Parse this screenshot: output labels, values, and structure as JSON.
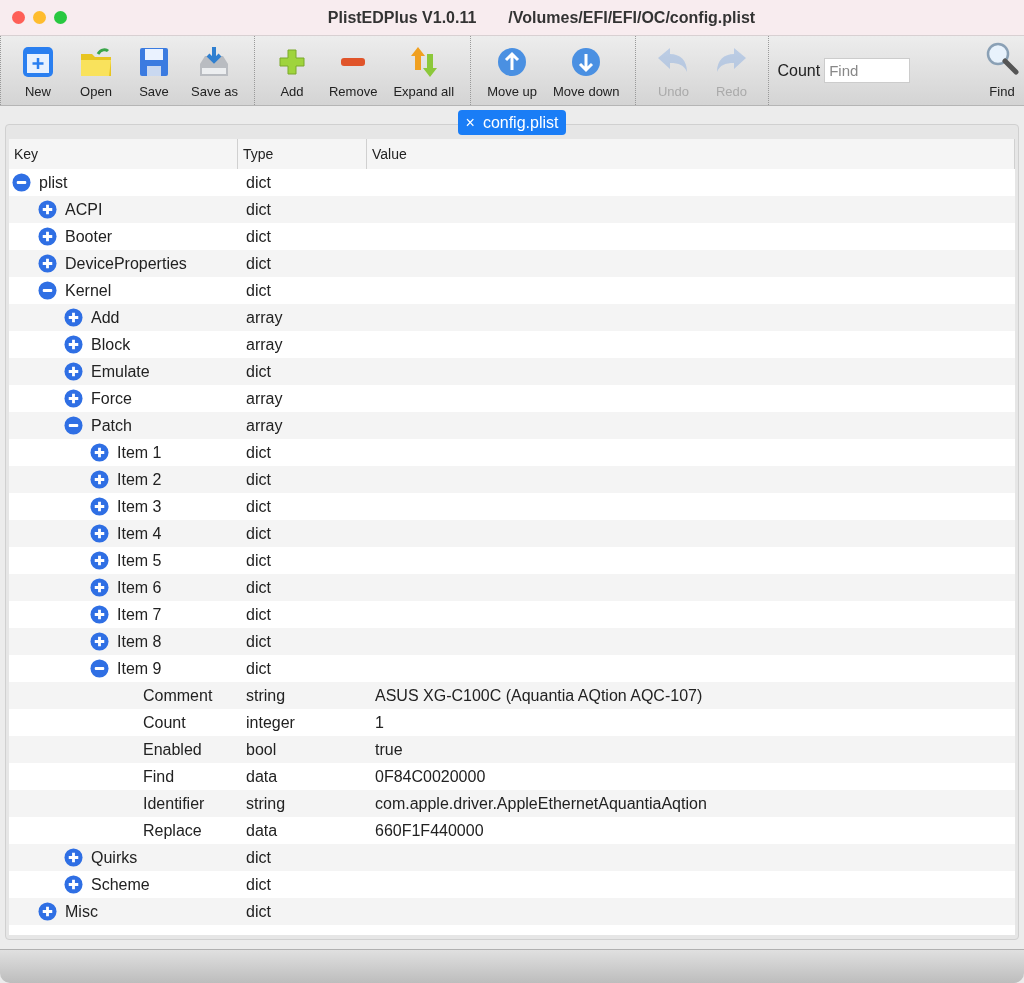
{
  "window": {
    "title": "PlistEDPlus V1.0.11",
    "path": "/Volumes/EFI/EFI/OC/config.plist"
  },
  "toolbar": {
    "groups": [
      [
        {
          "kind": "new",
          "label": "New",
          "disabled": false
        },
        {
          "kind": "open",
          "label": "Open",
          "disabled": false
        },
        {
          "kind": "save",
          "label": "Save",
          "disabled": false
        },
        {
          "kind": "saveas",
          "label": "Save as",
          "disabled": false
        }
      ],
      [
        {
          "kind": "add",
          "label": "Add",
          "disabled": false
        },
        {
          "kind": "remove",
          "label": "Remove",
          "disabled": false
        },
        {
          "kind": "expand",
          "label": "Expand all",
          "disabled": false
        }
      ],
      [
        {
          "kind": "up",
          "label": "Move up",
          "disabled": false
        },
        {
          "kind": "down",
          "label": "Move down",
          "disabled": false
        }
      ],
      [
        {
          "kind": "undo",
          "label": "Undo",
          "disabled": true
        },
        {
          "kind": "redo",
          "label": "Redo",
          "disabled": true
        }
      ]
    ],
    "count_label": "Count",
    "find_placeholder": "Find",
    "find_button": "Find"
  },
  "tabs": [
    {
      "label": "config.plist",
      "close": "×",
      "selected": true
    }
  ],
  "table": {
    "columns": [
      "Key",
      "Type",
      "Value"
    ],
    "rows": [
      {
        "key": "plist",
        "type": "dict",
        "kind": "container",
        "expanded": true,
        "children": [
          {
            "key": "ACPI",
            "type": "dict",
            "kind": "container",
            "expanded": false
          },
          {
            "key": "Booter",
            "type": "dict",
            "kind": "container",
            "expanded": false
          },
          {
            "key": "DeviceProperties",
            "type": "dict",
            "kind": "container",
            "expanded": false
          },
          {
            "key": "Kernel",
            "type": "dict",
            "kind": "container",
            "expanded": true,
            "children": [
              {
                "key": "Add",
                "type": "array",
                "kind": "container",
                "expanded": false
              },
              {
                "key": "Block",
                "type": "array",
                "kind": "container",
                "expanded": false
              },
              {
                "key": "Emulate",
                "type": "dict",
                "kind": "container",
                "expanded": false
              },
              {
                "key": "Force",
                "type": "array",
                "kind": "container",
                "expanded": false
              },
              {
                "key": "Patch",
                "type": "array",
                "kind": "container",
                "expanded": true,
                "children": [
                  {
                    "key": "Item 1",
                    "type": "dict",
                    "kind": "container",
                    "expanded": false
                  },
                  {
                    "key": "Item 2",
                    "type": "dict",
                    "kind": "container",
                    "expanded": false
                  },
                  {
                    "key": "Item 3",
                    "type": "dict",
                    "kind": "container",
                    "expanded": false
                  },
                  {
                    "key": "Item 4",
                    "type": "dict",
                    "kind": "container",
                    "expanded": false
                  },
                  {
                    "key": "Item 5",
                    "type": "dict",
                    "kind": "container",
                    "expanded": false
                  },
                  {
                    "key": "Item 6",
                    "type": "dict",
                    "kind": "container",
                    "expanded": false
                  },
                  {
                    "key": "Item 7",
                    "type": "dict",
                    "kind": "container",
                    "expanded": false
                  },
                  {
                    "key": "Item 8",
                    "type": "dict",
                    "kind": "container",
                    "expanded": false
                  },
                  {
                    "key": "Item 9",
                    "type": "dict",
                    "kind": "container",
                    "expanded": true,
                    "children": [
                      {
                        "key": "Comment",
                        "type": "string",
                        "kind": "value",
                        "value": "ASUS XG-C100C (Aquantia AQtion AQC-107)"
                      },
                      {
                        "key": "Count",
                        "type": "integer",
                        "kind": "value",
                        "value": "1"
                      },
                      {
                        "key": "Enabled",
                        "type": "bool",
                        "kind": "value",
                        "value": "true"
                      },
                      {
                        "key": "Find",
                        "type": "data",
                        "kind": "value",
                        "value": "0F84C0020000"
                      },
                      {
                        "key": "Identifier",
                        "type": "string",
                        "kind": "value",
                        "value": "com.apple.driver.AppleEthernetAquantiaAqtion"
                      },
                      {
                        "key": "Replace",
                        "type": "data",
                        "kind": "value",
                        "value": "660F1F440000"
                      }
                    ]
                  }
                ]
              },
              {
                "key": "Quirks",
                "type": "dict",
                "kind": "container",
                "expanded": false
              },
              {
                "key": "Scheme",
                "type": "dict",
                "kind": "container",
                "expanded": false
              }
            ]
          },
          {
            "key": "Misc",
            "type": "dict",
            "kind": "container",
            "expanded": false
          }
        ]
      }
    ]
  }
}
